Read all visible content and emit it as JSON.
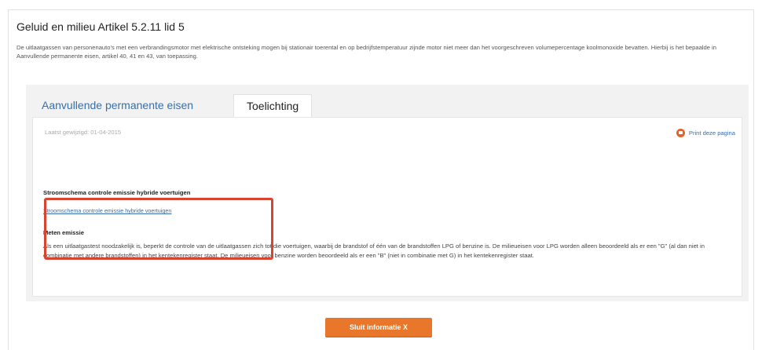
{
  "header": {
    "title": "Geluid en milieu Artikel 5.2.11 lid 5",
    "intro": "De uitlaatgassen van personenauto’s met een verbrandingsmotor met elektrische ontsteking mogen bij stationair toerental en op bedrijfstemperatuur zijnde motor niet meer dan het voorgeschreven volumepercentage koolmonoxide bevatten. Hierbij is het bepaalde in Aanvullende permanente eisen, artikel 40, 41 en 43, van toepassing."
  },
  "tabs": [
    {
      "label": "Aanvullende permanente eisen",
      "active": false
    },
    {
      "label": "Toelichting",
      "active": true
    }
  ],
  "content": {
    "updated": "Laatst gewijzigd: 01-04-2015",
    "print_label": "Print deze pagina",
    "print_icon": "printer-icon",
    "flow_section": {
      "heading": "Stroomschema controle emissie hybride voertuigen",
      "link": "Stroomschema controle emissie hybride voertuigen"
    },
    "measure_section": {
      "heading": "Meten emissie",
      "text": "Als een uitlaatgastest noodzakelijk is, beperkt de controle van de uitlaatgassen zich tot die voertuigen, waarbij de brandstof of één van de brandstoffen LPG of benzine is. De milieueisen voor LPG worden alleen beoordeeld als er een \"G\" (al dan niet in combinatie met andere brandstoffen) in het kentekenregister staat. De milieueisen voor benzine worden beoordeeld als er een \"B\" (niet in combinatie met G) in het kentekenregister staat."
    }
  },
  "footer": {
    "close_label": "Sluit informatie X"
  },
  "colors": {
    "accent": "#e8762b",
    "link": "#3a6ea8",
    "highlight": "#d9442e"
  }
}
